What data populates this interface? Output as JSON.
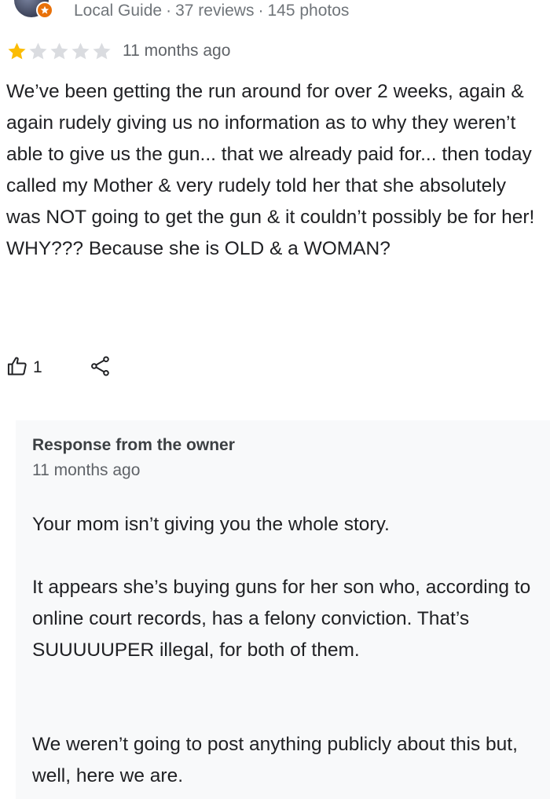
{
  "reviewer": {
    "badge_icon": "local-guide-badge-icon",
    "level": "Local Guide",
    "separator": "·",
    "reviews": "37 reviews",
    "photos": "145 photos"
  },
  "review": {
    "rating": 1,
    "max_rating": 5,
    "star_filled_color": "#fbbc04",
    "star_empty_color": "#dadce0",
    "time": "11 months ago",
    "text": "We’ve been getting the run around for over 2 weeks, again & again rudely giving us no information as to why they weren’t able to give us the gun... that we already paid for... then today called my Mother & very rudely told her that she absolutely was NOT going to get the gun & it couldn’t possibly be for her! WHY??? Because she is OLD & a WOMAN?",
    "like_icon": "thumbs-up-icon",
    "like_count": "1",
    "share_icon": "share-icon"
  },
  "response": {
    "title": "Response from the owner",
    "time": "11 months ago",
    "paragraphs": [
      "Your mom isn’t giving you the whole story.",
      "It appears she’s buying guns for her son who, according to online court records, has a felony conviction. That’s SUUUUUPER illegal, for both of them.",
      "We weren’t going to post anything publicly about this but, well, here we are."
    ]
  }
}
